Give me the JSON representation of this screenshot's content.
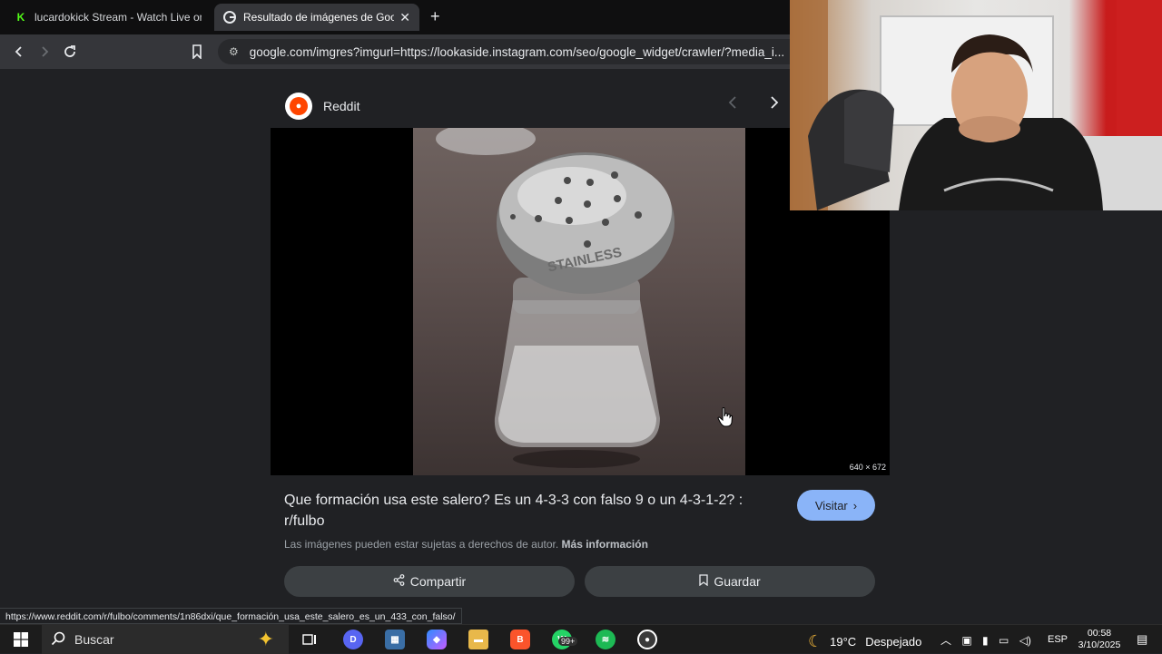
{
  "browser": {
    "tabs": [
      {
        "label": "lucardokick Stream - Watch Live on K",
        "favicon": "kick-icon",
        "active": false
      },
      {
        "label": "Resultado de imágenes de Goog",
        "favicon": "google-icon",
        "active": true
      }
    ],
    "new_tab_symbol": "+",
    "url": "google.com/imgres?imgurl=https://lookaside.instagram.com/seo/google_widget/crawler/?media_i..."
  },
  "panel": {
    "source_name": "Reddit",
    "image_dimensions": "640 × 672",
    "title": "Que formación usa este salero? Es un 4-3-3 con falso 9 o un 4-3-1-2? : r/fulbo",
    "visit_label": "Visitar",
    "copyright_text": "Las imágenes pueden estar sujetas a derechos de autor.",
    "more_info_label": "Más información",
    "share_label": "Compartir",
    "save_label": "Guardar",
    "shaker_text": "STAINLESS"
  },
  "status_link": "https://www.reddit.com/r/fulbo/comments/1n86dxi/que_formación_usa_este_salero_es_un_433_con_falso/",
  "taskbar": {
    "search_label": "Buscar",
    "whatsapp_badge": "99+",
    "weather_temp": "19°C",
    "weather_desc": "Despejado",
    "language": "ESP",
    "time": "00:58",
    "date": "3/10/2025"
  },
  "colors": {
    "accent_blue": "#8ab4f8",
    "reddit_orange": "#ff4500",
    "kick_green": "#53fc18"
  }
}
